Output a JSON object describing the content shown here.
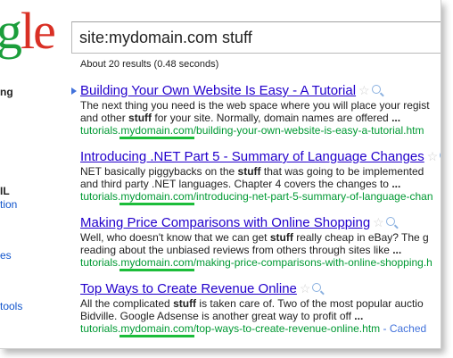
{
  "logo": {
    "letters": [
      {
        "ch": "g",
        "color": "#1b9e3b"
      },
      {
        "ch": "l",
        "color": "#d93025"
      },
      {
        "ch": "e",
        "color": "#d93025"
      }
    ]
  },
  "search": {
    "query": "site:mydomain.com stuff"
  },
  "stats": "About 20 results (0.48 seconds)",
  "sidebar": {
    "items": [
      {
        "label": "ng",
        "style": "bold"
      },
      {
        "label": "IL",
        "style": "bold"
      },
      {
        "label": "tion",
        "style": "link"
      },
      {
        "label": "es",
        "style": "link"
      },
      {
        "label": "tools",
        "style": "link"
      }
    ]
  },
  "results": [
    {
      "title": "Building Your Own Website Is Easy - A Tutorial",
      "snippet1_pre": "The next thing you need is the web space where you will place your regist",
      "snippet2_pre": "and other ",
      "snippet2_bold": "stuff",
      "snippet2_post": " for your site. Normally, domain names are offered ",
      "snippet2_ellipsis": "...",
      "url_pre": "tutorials.",
      "url_hl": "mydomain.com",
      "url_post": "/building-your-own-website-is-easy-a-tutorial.htm",
      "cached": ""
    },
    {
      "title": "Introducing .NET Part 5 - Summary of Language Changes",
      "snippet1_pre": "NET basically piggybacks on the ",
      "snippet1_bold": "stuff",
      "snippet1_post": " that was going to be implemented",
      "snippet2_pre": "and third party .NET languages. Chapter 4 covers the changes to ",
      "snippet2_ellipsis": "...",
      "url_pre": "tutorials.",
      "url_hl": "mydomain.com",
      "url_post": "/introducing-net-part-5-summary-of-language-chan",
      "cached": ""
    },
    {
      "title": "Making Price Comparisons with Online Shopping",
      "snippet1_pre": "Well, who doesn't know that we can get ",
      "snippet1_bold": "stuff",
      "snippet1_post": " really cheap in eBay? The g",
      "snippet2_pre": "reading about the unbiased reviews from others through sites like ",
      "snippet2_ellipsis": "...",
      "url_pre": "tutorials.",
      "url_hl": "mydomain.com",
      "url_post": "/making-price-comparisons-with-online-shopping.h",
      "cached": ""
    },
    {
      "title": "Top Ways to Create Revenue Online",
      "snippet1_pre": "All the complicated ",
      "snippet1_bold": "stuff",
      "snippet1_post": " is taken care of. Two of the most popular auctio",
      "snippet2_pre": "Bidville. Google Adsense is another great way to profit off ",
      "snippet2_ellipsis": "...",
      "url_pre": "tutorials.",
      "url_hl": "mydomain.com",
      "url_post": "/top-ways-to-create-revenue-online.htm",
      "cached": " - Cached"
    }
  ],
  "icons": {
    "star": "☆",
    "preview": "magnifier-icon",
    "arrow": "triangle-right-icon"
  },
  "colors": {
    "title_link": "#2200cc",
    "url_green": "#009933",
    "highlight": "#1cbd3a",
    "sidebar_link": "#1155cc"
  }
}
